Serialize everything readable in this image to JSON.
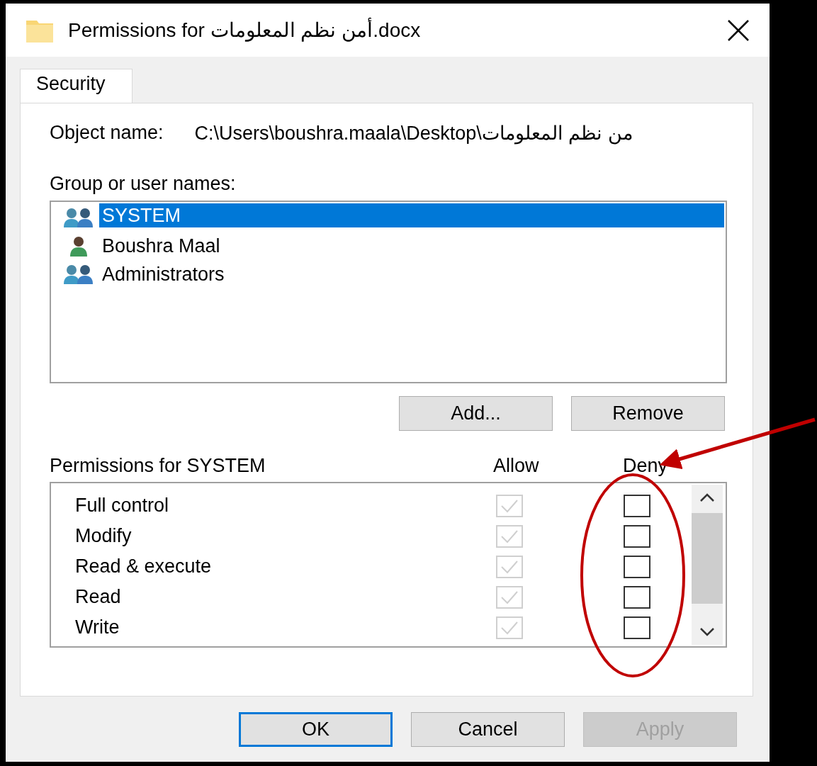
{
  "window": {
    "title": "Permissions for أمن نظم المعلومات.docx"
  },
  "tabs": [
    {
      "label": "Security",
      "selected": true
    }
  ],
  "object_name": {
    "label": "Object name:",
    "value": "C:\\Users\\boushra.maala\\Desktop\\من نظم المعلومات"
  },
  "group_label": "Group or user names:",
  "users": [
    {
      "name": "SYSTEM",
      "kind": "group",
      "selected": true
    },
    {
      "name": "Boushra Maal",
      "kind": "user",
      "selected": false
    },
    {
      "name": "Administrators",
      "kind": "group",
      "selected": false
    }
  ],
  "user_buttons": [
    "Add...",
    "Remove"
  ],
  "permissions_header": {
    "title": "Permissions for SYSTEM",
    "allow": "Allow",
    "deny": "Deny"
  },
  "permissions": [
    {
      "name": "Full control",
      "allow_checked": true,
      "allow_disabled": true,
      "deny_checked": false,
      "deny_disabled": false
    },
    {
      "name": "Modify",
      "allow_checked": true,
      "allow_disabled": true,
      "deny_checked": false,
      "deny_disabled": false
    },
    {
      "name": "Read & execute",
      "allow_checked": true,
      "allow_disabled": true,
      "deny_checked": false,
      "deny_disabled": false
    },
    {
      "name": "Read",
      "allow_checked": true,
      "allow_disabled": true,
      "deny_checked": false,
      "deny_disabled": false
    },
    {
      "name": "Write",
      "allow_checked": true,
      "allow_disabled": true,
      "deny_checked": false,
      "deny_disabled": false
    }
  ],
  "buttons": [
    {
      "label": "OK",
      "default": true,
      "disabled": false
    },
    {
      "label": "Cancel",
      "default": false,
      "disabled": false
    },
    {
      "label": "Apply",
      "default": false,
      "disabled": true
    }
  ]
}
